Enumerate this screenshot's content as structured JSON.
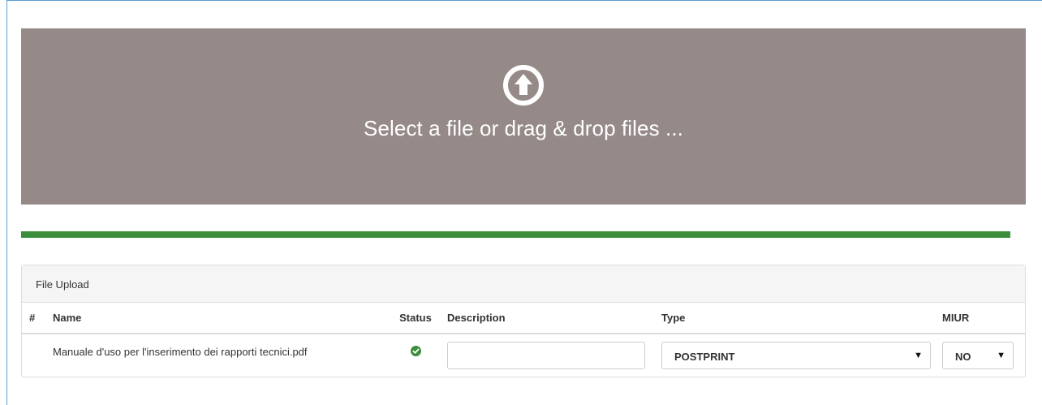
{
  "dropzone": {
    "icon": "circle-arrow-up-icon",
    "text": "Select a file or drag & drop files ..."
  },
  "progress": {
    "value_percent": 100,
    "color": "#3c8d3c"
  },
  "panel": {
    "title": "File Upload",
    "columns": {
      "hash": "#",
      "name": "Name",
      "status": "Status",
      "description": "Description",
      "type": "Type",
      "miur": "MIUR"
    },
    "rows": [
      {
        "name": "Manuale d'uso per l'inserimento dei rapporti tecnici.pdf",
        "status_icon": "check-circle-icon",
        "status_color": "#3c8d3c",
        "description_value": "",
        "type_value": "POSTPRINT",
        "miur_value": "NO"
      }
    ]
  },
  "colors": {
    "dropzone_bg": "#958a88",
    "frame_border": "#5b9bd5"
  }
}
